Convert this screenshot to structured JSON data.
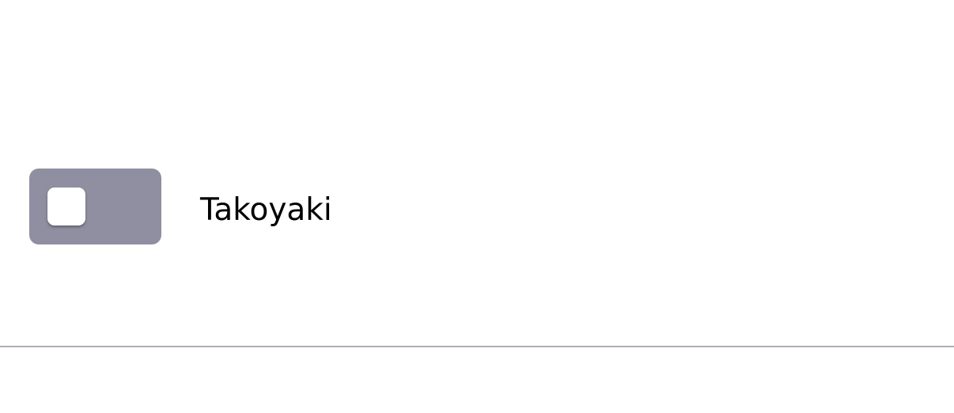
{
  "toggle": {
    "label": "Takoyaki",
    "state": "off"
  },
  "colors": {
    "track_off": "#908fa1",
    "knob": "#ffffff",
    "divider": "#aeadbb",
    "text": "#000000"
  }
}
